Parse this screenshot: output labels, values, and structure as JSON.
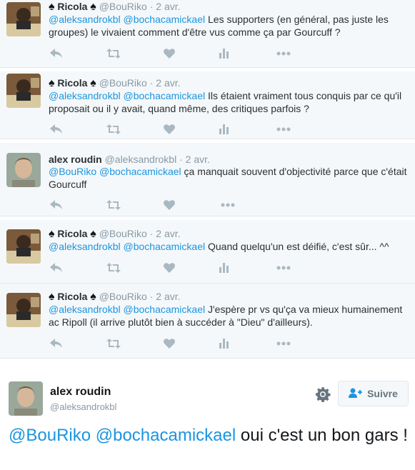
{
  "colors": {
    "mention": "#1b95e0",
    "meta": "#8899a6",
    "icon": "#aab8c2",
    "bg": "#f5f8fa"
  },
  "tweets": [
    {
      "name": "Ricola",
      "spade_left": "♠",
      "spade_right": "♠",
      "handle": "@BouRiko",
      "time": "2 avr.",
      "mention1": "@aleksandrokbl",
      "mention2": "@bochacamickael",
      "text": "Les supporters (en général, pas juste les groupes) le vivaient comment d'être vus comme ça par Gourcuff ?"
    },
    {
      "name": "Ricola",
      "spade_left": "♠",
      "spade_right": "♠",
      "handle": "@BouRiko",
      "time": "2 avr.",
      "mention1": "@aleksandrokbl",
      "mention2": "@bochacamickael",
      "text": "Ils étaient vraiment tous conquis par ce qu'il proposait ou il y avait, quand même, des critiques parfois ?"
    },
    {
      "name": "alex roudin",
      "handle": "@aleksandrokbl",
      "time": "2 avr.",
      "mention1": "@BouRiko",
      "mention2": "@bochacamickael",
      "text": "ça manquait souvent d'objectivité parce que c'était Gourcuff"
    },
    {
      "name": "Ricola",
      "spade_left": "♠",
      "spade_right": "♠",
      "handle": "@BouRiko",
      "time": "2 avr.",
      "mention1": "@aleksandrokbl",
      "mention2": "@bochacamickael",
      "text": "Quand quelqu'un est déifié, c'est sûr... ^^"
    },
    {
      "name": "Ricola",
      "spade_left": "♠",
      "spade_right": "♠",
      "handle": "@BouRiko",
      "time": "2 avr.",
      "mention1": "@aleksandrokbl",
      "mention2": "@bochacamickael",
      "text": "J'espère pr vs qu'ça va mieux humainement ac Ripoll (il arrive plutôt bien à succéder à \"Dieu\" d'ailleurs)."
    }
  ],
  "expanded": {
    "name": "alex roudin",
    "handle": "@aleksandrokbl",
    "follow_label": "Suivre",
    "mention1": "@BouRiko",
    "mention2": "@bochacamickael",
    "text": "oui c'est un bon gars !"
  },
  "icons": {
    "reply": "reply-icon",
    "retweet": "retweet-icon",
    "like": "heart-icon",
    "analytics": "analytics-icon",
    "more": "more-icon",
    "gear": "gear-icon",
    "follow": "follow-user-icon"
  }
}
